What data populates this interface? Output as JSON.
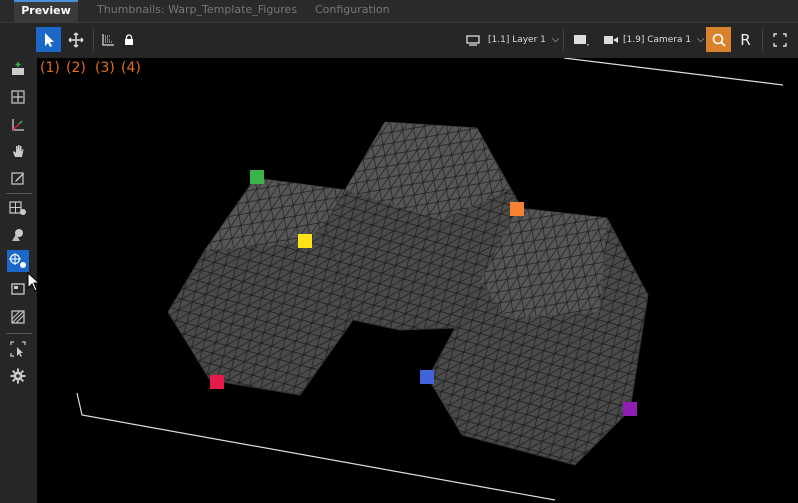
{
  "tabs": [
    {
      "label": "Preview",
      "active": true
    },
    {
      "label": "Thumbnails: Warp_Template_Figures",
      "active": false
    },
    {
      "label": "Configuration",
      "active": false
    }
  ],
  "toolbar": {
    "layer_label": "[1.1] Layer 1",
    "camera_label": "[1.9] Camera 1",
    "r_label": "R"
  },
  "annotations": [
    "(1)",
    "(2)",
    "(3)",
    "(4)"
  ],
  "colors": {
    "accent": "#1c68c8",
    "orange": "#d9822b",
    "annotation": "#e26b1e",
    "marker_green": "#3cb44b",
    "marker_yellow": "#ffe119",
    "marker_orange": "#f58231",
    "marker_red": "#e6194b",
    "marker_blue": "#4363d8",
    "marker_purple": "#911eb4"
  },
  "sidebar_icons": [
    "layer-add-icon",
    "move-grid-icon",
    "axis-icon",
    "hand-icon",
    "edit-icon",
    "warp-grid-icon",
    "shapes-icon",
    "warp-points-icon",
    "image-frame-icon",
    "mesh-icon",
    "select-area-icon",
    "settings-gear-icon"
  ]
}
